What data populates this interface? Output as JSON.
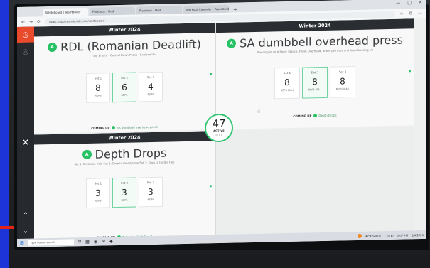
{
  "browser": {
    "tabs": [
      {
        "label": "Whiteboard | TeamBuildr",
        "active": true
      },
      {
        "label": "Playbook - Hudl",
        "active": false
      },
      {
        "label": "Playbook - Hudl",
        "active": false
      },
      {
        "label": "Workout Calendar | TeamBuildr",
        "active": false
      }
    ],
    "new_tab": "+",
    "url": "https://app.teambuildr.com/whiteboard",
    "nav": {
      "back": "←",
      "forward": "→",
      "reload": "⟳"
    },
    "window_controls": {
      "minimize": "—",
      "maximize": "□",
      "close": "✕"
    },
    "toolbar_icons": [
      "☆",
      "⧉",
      "⋯"
    ]
  },
  "sidebar": {
    "top_icon": "◷",
    "second_icon": "◎",
    "close_icon": "✕",
    "up_icon": "⌃",
    "down_icon": "⌄"
  },
  "panels": [
    {
      "season": "Winter 2024",
      "badge": "A",
      "title": "RDL (Romanian Deadlift)",
      "cue": "Big Breath - Control Down Phase - Explode Up",
      "sets": [
        {
          "label": "Set 1",
          "value": "8",
          "unit": "REPS",
          "current": false
        },
        {
          "label": "Set 2",
          "value": "6",
          "unit": "REPS",
          "current": true
        },
        {
          "label": "Set 3",
          "value": "4",
          "unit": "REPS",
          "current": false
        }
      ],
      "coming_label": "COMING UP",
      "coming_next": "SA dumbbell overhead press"
    },
    {
      "season": "Winter 2024",
      "badge": "A",
      "title": "SA dumbbell overhead press",
      "cue": "Standing in an Athletic Stance. Finish Overhead. Brace you Core and Avoid Looking Up",
      "sets": [
        {
          "label": "Set 1",
          "value": "8",
          "unit": "REPS (EA.)",
          "current": false
        },
        {
          "label": "Set 2",
          "value": "8",
          "unit": "REPS (EA.)",
          "current": true
        },
        {
          "label": "Set 3",
          "value": "8",
          "unit": "REPS (EA.)",
          "current": false
        }
      ],
      "coming_label": "COMING UP",
      "coming_next": "Depth Drops"
    },
    {
      "season": "Winter 2024",
      "badge": "A",
      "title": "Depth Drops",
      "cue": "Set 1: Stick and Hold Set 2: Drop to Broad Jump Set 3: Drop to Hurdle Hop",
      "sets": [
        {
          "label": "Set 1",
          "value": "3",
          "unit": "REPS",
          "current": false
        },
        {
          "label": "Set 2",
          "value": "3",
          "unit": "REPS",
          "current": true
        },
        {
          "label": "Set 3",
          "value": "3",
          "unit": "REPS",
          "current": false
        }
      ],
      "coming_label": "COMING UP",
      "coming_next": "Bulgarian Split Squat"
    }
  ],
  "timer": {
    "value": "47",
    "label": "ACTIVE",
    "controls": "▷ ▢"
  },
  "taskbar": {
    "start_icon": "⊞",
    "search_placeholder": "Type here to search",
    "apps": [
      "⧉",
      "▦",
      "◉",
      "✉",
      "◆"
    ],
    "weather": "42°F Sunny",
    "tray_icons": "⌃ ▭ ◖)",
    "time": "3:07 PM",
    "date": "2/4/2025"
  },
  "colors": {
    "accent_green": "#27c266",
    "sidebar_red": "#e84a2b",
    "season_bar": "#2a2e33"
  }
}
